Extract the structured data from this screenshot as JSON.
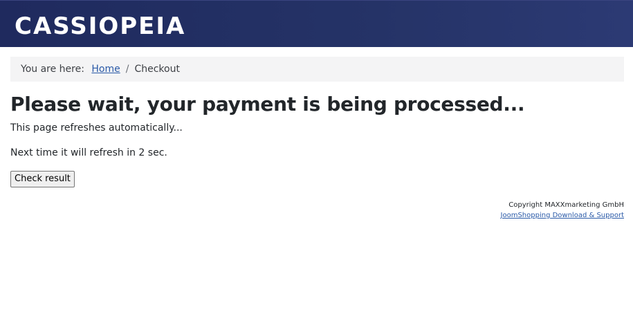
{
  "header": {
    "brand": "CASSIOPEIA",
    "background": "#253367"
  },
  "breadcrumb": {
    "prefix": "You are here:",
    "items": [
      {
        "label": "Home",
        "link": true
      },
      {
        "label": "Checkout",
        "link": false
      }
    ],
    "separator": "/"
  },
  "main": {
    "title": "Please wait, your payment is being processed...",
    "message_1": "This page refreshes automatically...",
    "message_2": "Next time it will refresh in 2 sec.",
    "check_button_label": "Check result"
  },
  "footer": {
    "copyright": "Copyright MAXXmarketing GmbH",
    "link_label": "JoomShopping Download & Support"
  },
  "colors": {
    "link": "#2a5aa8",
    "text": "#22262a",
    "breadcrumb_bg": "#f4f4f5"
  }
}
